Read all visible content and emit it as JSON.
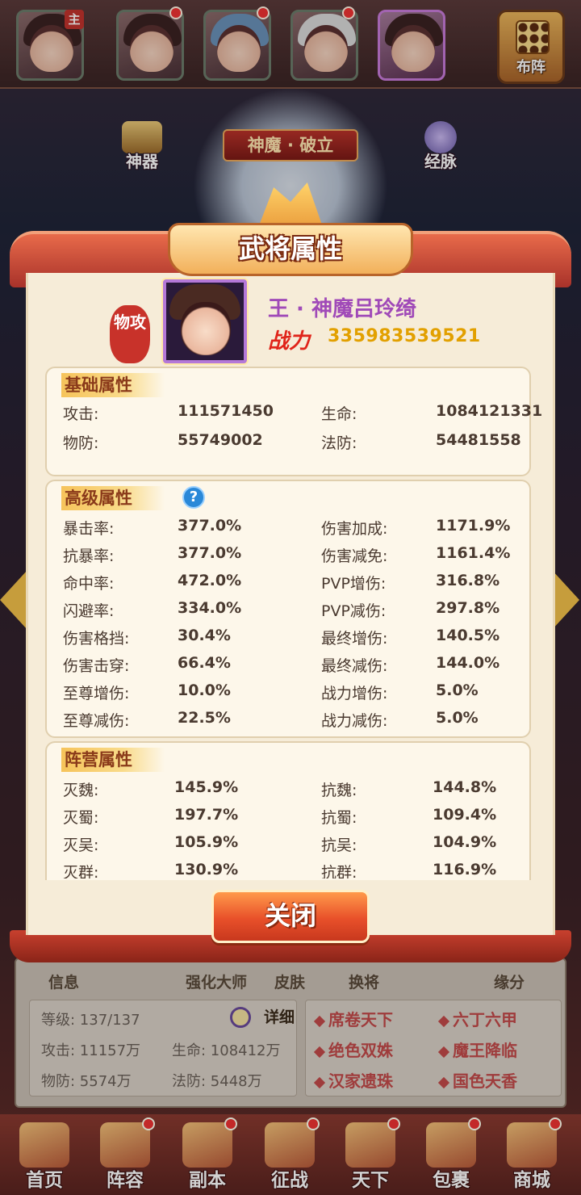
{
  "top_bar": {
    "lord_tag": "主",
    "formation_label": "布阵"
  },
  "mid_buttons": {
    "artifact": "神器",
    "meridian": "经脉",
    "banner": "神魔 · 破立"
  },
  "modal": {
    "title": "武将属性",
    "class_seal": "物攻",
    "hero_name": "王 · 神魔吕玲绮",
    "power_label": "战力",
    "power_value": "335983539521",
    "basic": {
      "heading": "基础属性",
      "rows": [
        [
          "攻击:",
          "111571450",
          "生命:",
          "1084121331"
        ],
        [
          "物防:",
          "55749002",
          "法防:",
          "54481558"
        ]
      ]
    },
    "advanced": {
      "heading": "高级属性",
      "help": "?",
      "rows": [
        [
          "暴击率:",
          "377.0%",
          "伤害加成:",
          "1171.9%"
        ],
        [
          "抗暴率:",
          "377.0%",
          "伤害减免:",
          "1161.4%"
        ],
        [
          "命中率:",
          "472.0%",
          "PVP增伤:",
          "316.8%"
        ],
        [
          "闪避率:",
          "334.0%",
          "PVP减伤:",
          "297.8%"
        ],
        [
          "伤害格挡:",
          "30.4%",
          "最终增伤:",
          "140.5%"
        ],
        [
          "伤害击穿:",
          "66.4%",
          "最终减伤:",
          "144.0%"
        ],
        [
          "至尊增伤:",
          "10.0%",
          "战力增伤:",
          "5.0%"
        ],
        [
          "至尊减伤:",
          "22.5%",
          "战力减伤:",
          "5.0%"
        ]
      ]
    },
    "faction": {
      "heading": "阵营属性",
      "rows": [
        [
          "灭魏:",
          "145.9%",
          "抗魏:",
          "144.8%"
        ],
        [
          "灭蜀:",
          "197.7%",
          "抗蜀:",
          "109.4%"
        ],
        [
          "灭吴:",
          "105.9%",
          "抗吴:",
          "104.9%"
        ],
        [
          "灭群:",
          "130.9%",
          "抗群:",
          "116.9%"
        ]
      ]
    },
    "close_label": "关闭"
  },
  "info_panel": {
    "tabs": [
      "信息",
      "强化大师",
      "皮肤",
      "换将",
      "缘分"
    ],
    "level": "等级: 137/137",
    "detail": "详细",
    "attack": "攻击: 11157万",
    "hp": "生命: 108412万",
    "pdef": "物防: 5574万",
    "mdef": "法防: 5448万",
    "fates": [
      "席卷天下",
      "六丁六甲",
      "绝色双姝",
      "魔王降临",
      "汉家遗珠",
      "国色天香"
    ]
  },
  "bottom_nav": [
    "首页",
    "阵容",
    "副本",
    "征战",
    "天下",
    "包裹",
    "商城"
  ]
}
